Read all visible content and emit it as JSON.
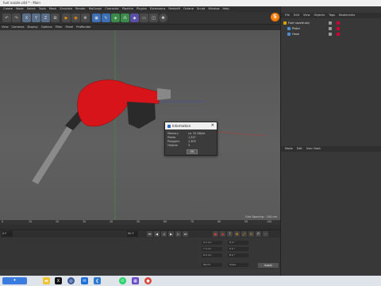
{
  "window": {
    "title": "fuel nozzle.c4d * - Main"
  },
  "menubar": [
    "Create",
    "Mode",
    "Select",
    "Tools",
    "Mesh",
    "Simulate",
    "Render",
    "MoGraph",
    "Character",
    "Pipeline",
    "Plugins",
    "Extensions",
    "Redshift",
    "Octane",
    "Script",
    "Window",
    "Help"
  ],
  "toolbar_icons": [
    "undo-icon",
    "redo-icon",
    "move-icon",
    "scale-icon",
    "rotate-icon",
    "x-axis",
    "y-axis",
    "z-axis",
    "coordinate-system-icon",
    "render-view-icon",
    "render-settings-icon",
    "cube-icon",
    "pen-icon",
    "subdivide-icon",
    "array-icon",
    "deformer-icon",
    "floor-icon",
    "camera-icon",
    "light-icon",
    "c4d-logo"
  ],
  "viewmenu": [
    "View",
    "Cameras",
    "Display",
    "Options",
    "Filter",
    "Panel",
    "ProRender"
  ],
  "viewport": {
    "grid_spacing": "Grid Spacing : 100 cm"
  },
  "dialog": {
    "title": "Information",
    "rows": [
      {
        "label": "Memory",
        "value": "ca. 33 KByte"
      },
      {
        "label": "Points",
        "value": "1,337"
      },
      {
        "label": "Polygons",
        "value": "1,305"
      },
      {
        "label": "Objects",
        "value": "3"
      }
    ],
    "ok": "OK"
  },
  "object_manager": {
    "menu": [
      "File",
      "Edit",
      "View",
      "Objects",
      "Tags",
      "Bookmarks"
    ],
    "items": [
      {
        "name": "Fuel nozzle.obj",
        "color": "#e0a000"
      },
      {
        "name": "Pistol",
        "color": "#4b8fd6"
      },
      {
        "name": "Hose",
        "color": "#4b8fd6"
      }
    ]
  },
  "attributes": {
    "menu": [
      "Mode",
      "Edit",
      "User Data"
    ]
  },
  "timeline": {
    "ticks": [
      "0",
      "10",
      "20",
      "30",
      "40",
      "50",
      "60",
      "70",
      "80",
      "90",
      "100"
    ],
    "start_frame": "0 F",
    "end_frame": "90 F"
  },
  "coords": {
    "labels": [
      "X",
      "Y",
      "Z",
      "H",
      "P",
      "B"
    ],
    "values": [
      "0 cm",
      "0 cm",
      "0 cm",
      "0 °",
      "0 °",
      "0 °"
    ],
    "mode1": "World",
    "mode2": "Scale",
    "apply": "Apply"
  },
  "taskbar": {
    "start_label": "",
    "apps": [
      "file-explorer-icon",
      "x-icon",
      "chrome-icon",
      "mail-icon",
      "vscode-icon",
      "whatsapp-icon",
      "photos-icon",
      "settings-icon"
    ]
  }
}
